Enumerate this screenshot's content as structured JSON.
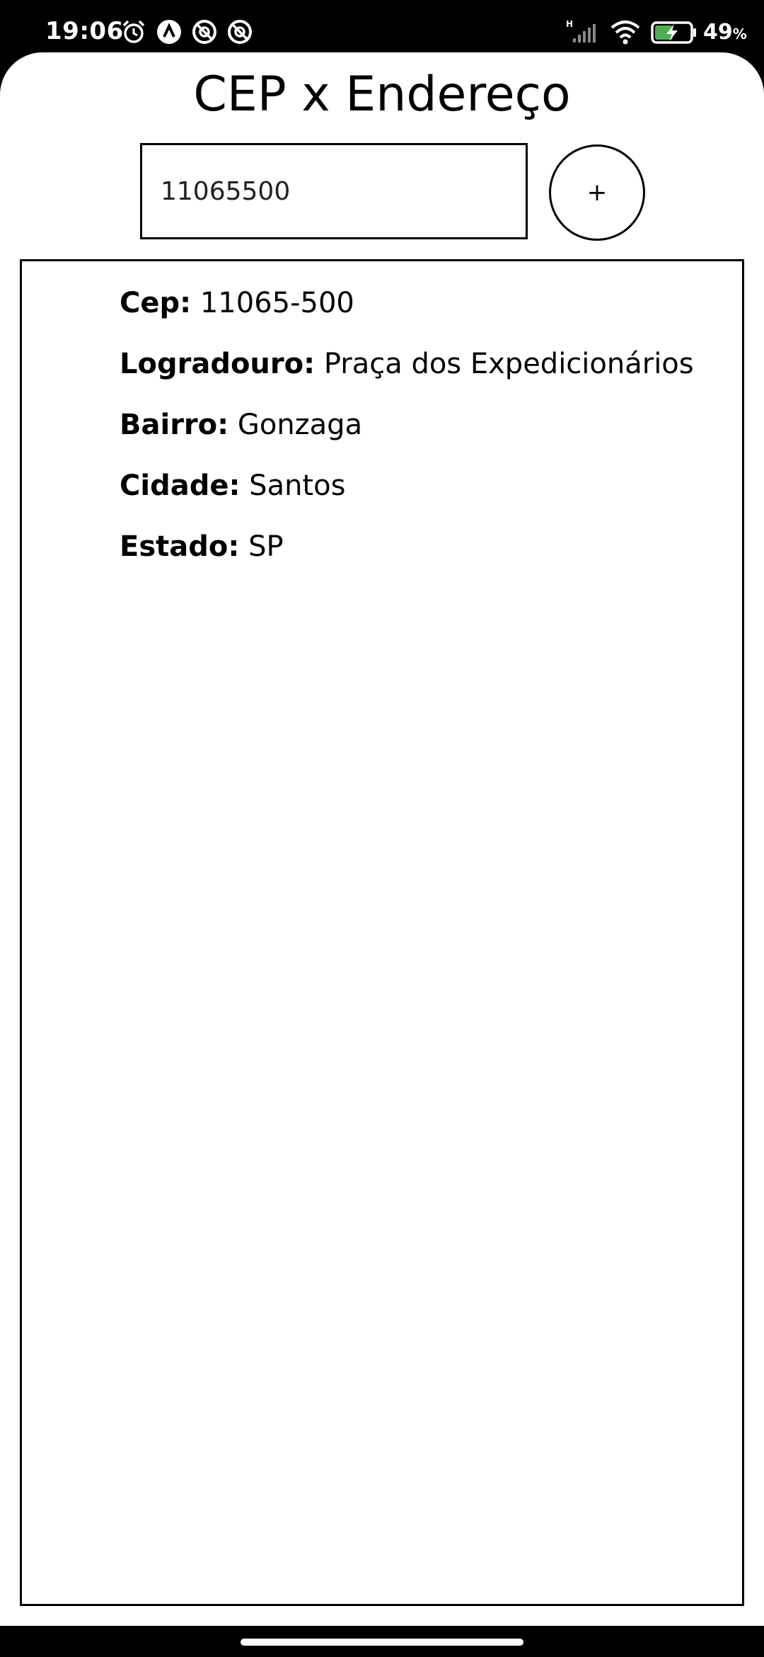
{
  "status_bar": {
    "time": "19:06",
    "icons": [
      "alarm-icon",
      "app-notification-icon",
      "app-notification-icon",
      "app-notification-icon",
      "signal-icon",
      "wifi-icon",
      "battery-charging-icon"
    ],
    "network_type": "H",
    "battery_percent": "49",
    "battery_unit": "%"
  },
  "app": {
    "title": "CEP x Endereço",
    "cep_input": {
      "value": "11065500",
      "placeholder": ""
    },
    "add_button_label": "+"
  },
  "result": {
    "cep": {
      "label": "Cep:",
      "value": "11065-500"
    },
    "logradouro": {
      "label": "Logradouro:",
      "value": "Praça dos Expedicionários"
    },
    "bairro": {
      "label": "Bairro:",
      "value": "Gonzaga"
    },
    "cidade": {
      "label": "Cidade:",
      "value": "Santos"
    },
    "estado": {
      "label": "Estado:",
      "value": "SP"
    }
  },
  "colors": {
    "accent": "#000000",
    "background": "#ffffff",
    "battery_charge": "#4caf50"
  }
}
